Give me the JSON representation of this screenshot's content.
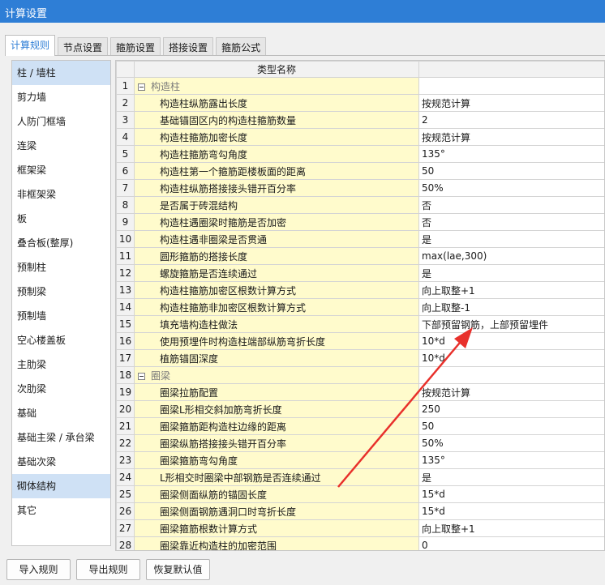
{
  "window": {
    "title": "计算设置"
  },
  "tabs": [
    "计算规则",
    "节点设置",
    "箍筋设置",
    "搭接设置",
    "箍筋公式"
  ],
  "sidebar": [
    "柱 / 墙柱",
    "剪力墙",
    "人防门框墙",
    "连梁",
    "框架梁",
    "非框架梁",
    "板",
    "叠合板(整厚)",
    "预制柱",
    "预制梁",
    "预制墙",
    "空心楼盖板",
    "主肋梁",
    "次肋梁",
    "基础",
    "基础主梁 / 承台梁",
    "基础次梁",
    "砌体结构",
    "其它"
  ],
  "table": {
    "header": "类型名称",
    "rows": [
      {
        "num": "1",
        "name": "构造柱",
        "value": "",
        "group": true
      },
      {
        "num": "2",
        "name": "构造柱纵筋露出长度",
        "value": "按规范计算"
      },
      {
        "num": "3",
        "name": "基础锚固区内的构造柱箍筋数量",
        "value": "2"
      },
      {
        "num": "4",
        "name": "构造柱箍筋加密长度",
        "value": "按规范计算"
      },
      {
        "num": "5",
        "name": "构造柱箍筋弯勾角度",
        "value": "135°"
      },
      {
        "num": "6",
        "name": "构造柱第一个箍筋距楼板面的距离",
        "value": "50"
      },
      {
        "num": "7",
        "name": "构造柱纵筋搭接接头错开百分率",
        "value": "50%"
      },
      {
        "num": "8",
        "name": "是否属于砖混结构",
        "value": "否"
      },
      {
        "num": "9",
        "name": "构造柱遇圈梁时箍筋是否加密",
        "value": "否"
      },
      {
        "num": "10",
        "name": "构造柱遇非圈梁是否贯通",
        "value": "是"
      },
      {
        "num": "11",
        "name": "圆形箍筋的搭接长度",
        "value": "max(lae,300)"
      },
      {
        "num": "12",
        "name": "螺旋箍筋是否连续通过",
        "value": "是"
      },
      {
        "num": "13",
        "name": "构造柱箍筋加密区根数计算方式",
        "value": "向上取整+1"
      },
      {
        "num": "14",
        "name": "构造柱箍筋非加密区根数计算方式",
        "value": "向上取整-1"
      },
      {
        "num": "15",
        "name": "填充墙构造柱做法",
        "value": "下部预留钢筋，上部预留埋件"
      },
      {
        "num": "16",
        "name": "使用预埋件时构造柱端部纵筋弯折长度",
        "value": "10*d"
      },
      {
        "num": "17",
        "name": "植筋锚固深度",
        "value": "10*d"
      },
      {
        "num": "18",
        "name": "圈梁",
        "value": "",
        "group": true
      },
      {
        "num": "19",
        "name": "圈梁拉筋配置",
        "value": "按规范计算"
      },
      {
        "num": "20",
        "name": "圈梁L形相交斜加筋弯折长度",
        "value": "250"
      },
      {
        "num": "21",
        "name": "圈梁箍筋距构造柱边缘的距离",
        "value": "50"
      },
      {
        "num": "22",
        "name": "圈梁纵筋搭接接头错开百分率",
        "value": "50%"
      },
      {
        "num": "23",
        "name": "圈梁箍筋弯勾角度",
        "value": "135°"
      },
      {
        "num": "24",
        "name": "L形相交时圈梁中部钢筋是否连续通过",
        "value": "是"
      },
      {
        "num": "25",
        "name": "圈梁侧面纵筋的锚固长度",
        "value": "15*d"
      },
      {
        "num": "26",
        "name": "圈梁侧面钢筋遇洞口时弯折长度",
        "value": "15*d"
      },
      {
        "num": "27",
        "name": "圈梁箍筋根数计算方式",
        "value": "向上取整+1"
      },
      {
        "num": "28",
        "name": "圈梁靠近构造柱的加密范围",
        "value": "0"
      }
    ]
  },
  "buttons": {
    "import": "导入规则",
    "export": "导出规则",
    "restore": "恢复默认值"
  },
  "colors": {
    "accent": "#2e7ed6",
    "name_cell_bg": "#fffbcc",
    "selected_bg": "#cfe1f5",
    "arrow": "#e8302b"
  }
}
